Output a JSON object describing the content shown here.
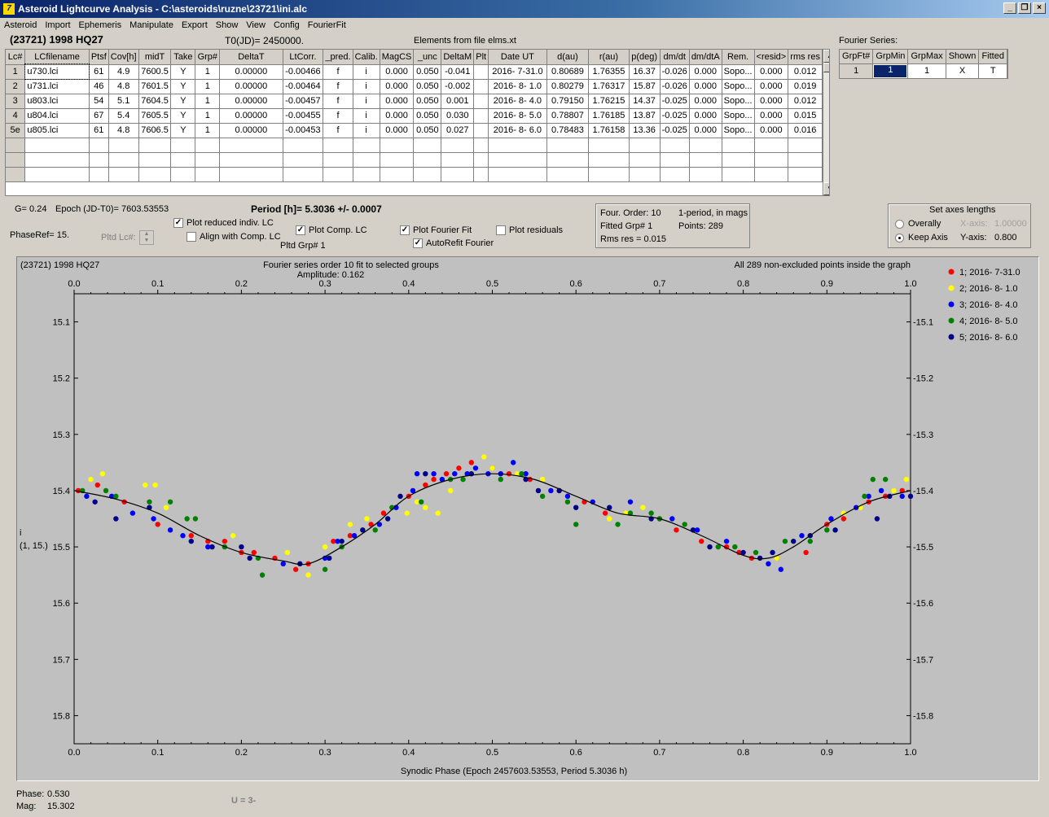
{
  "window": {
    "title": "Asteroid Lightcurve Analysis - C:\\asteroids\\ruzne\\23721\\ini.alc",
    "icon": "app-logo-icon"
  },
  "menu": [
    "Asteroid",
    "Import",
    "Ephemeris",
    "Manipulate",
    "Export",
    "Show",
    "View",
    "Config",
    "FourierFit"
  ],
  "header": {
    "object": "(23721) 1998 HQ27",
    "t0": "T0(JD)= 2450000.",
    "elements": "Elements from file elms.xt",
    "fourier_label": "Fourier Series:"
  },
  "lc_table": {
    "columns": [
      "Lc#",
      "LCfilename",
      "Ptsf",
      "Cov[h]",
      "midT",
      "Take",
      "Grp#",
      "DeltaT",
      "LtCorr.",
      "_pred.",
      "Calib.",
      "MagCS",
      "_unc",
      "DeltaM",
      "Plt",
      "Date UT",
      "d(au)",
      "r(au)",
      "p(deg)",
      "dm/dt",
      "dm/dtA",
      "Rem.",
      "<resid>",
      "rms res"
    ],
    "rows": [
      [
        "1",
        "u730.lci",
        "61",
        "4.9",
        "7600.5",
        "Y",
        "1",
        "0.00000",
        "-0.00466",
        "f",
        "i",
        "0.000",
        "0.050",
        "-0.041",
        "",
        "2016- 7-31.0",
        "0.80689",
        "1.76355",
        "16.37",
        "-0.026",
        "0.000",
        "Sopo...",
        "0.000",
        "0.012"
      ],
      [
        "2",
        "u731.lci",
        "46",
        "4.8",
        "7601.5",
        "Y",
        "1",
        "0.00000",
        "-0.00464",
        "f",
        "i",
        "0.000",
        "0.050",
        "-0.002",
        "",
        "2016- 8- 1.0",
        "0.80279",
        "1.76317",
        "15.87",
        "-0.026",
        "0.000",
        "Sopo...",
        "0.000",
        "0.019"
      ],
      [
        "3",
        "u803.lci",
        "54",
        "5.1",
        "7604.5",
        "Y",
        "1",
        "0.00000",
        "-0.00457",
        "f",
        "i",
        "0.000",
        "0.050",
        "0.001",
        "",
        "2016- 8- 4.0",
        "0.79150",
        "1.76215",
        "14.37",
        "-0.025",
        "0.000",
        "Sopo...",
        "0.000",
        "0.012"
      ],
      [
        "4",
        "u804.lci",
        "67",
        "5.4",
        "7605.5",
        "Y",
        "1",
        "0.00000",
        "-0.00455",
        "f",
        "i",
        "0.000",
        "0.050",
        "0.030",
        "",
        "2016- 8- 5.0",
        "0.78807",
        "1.76185",
        "13.87",
        "-0.025",
        "0.000",
        "Sopo...",
        "0.000",
        "0.015"
      ],
      [
        "5e",
        "u805.lci",
        "61",
        "4.8",
        "7606.5",
        "Y",
        "1",
        "0.00000",
        "-0.00453",
        "f",
        "i",
        "0.000",
        "0.050",
        "0.027",
        "",
        "2016- 8- 6.0",
        "0.78483",
        "1.76158",
        "13.36",
        "-0.025",
        "0.000",
        "Sopo...",
        "0.000",
        "0.016"
      ]
    ]
  },
  "fourier_table": {
    "columns": [
      "GrpFt#",
      "GrpMin",
      "GrpMax",
      "Shown",
      "Fitted"
    ],
    "row": [
      "1",
      "1",
      "1",
      "X",
      "T"
    ]
  },
  "params": {
    "g": "G= 0.24",
    "epoch": "Epoch (JD-T0)= 7603.53553",
    "period": "Period [h]= 5.3036 +/- 0.0007",
    "phaseref": "PhaseRef= 15.",
    "pltd_lc": "Pltd Lc#:",
    "pltd_grp": "Pltd Grp#  1"
  },
  "options": {
    "plot_reduced": {
      "label": "Plot reduced indiv. LC",
      "checked": true
    },
    "align_comp": {
      "label": "Align with Comp. LC",
      "checked": false
    },
    "plot_comp": {
      "label": "Plot Comp. LC",
      "checked": true
    },
    "plot_fourier": {
      "label": "Plot Fourier Fit",
      "checked": true
    },
    "autorefit": {
      "label": "AutoRefit Fourier",
      "checked": true
    },
    "plot_residuals": {
      "label": "Plot residuals",
      "checked": false
    }
  },
  "fit_info": {
    "order": "Four. Order: 10",
    "grp": "Fitted Grp# 1",
    "rms": "Rms res     = 0.015",
    "mode": "1-period, in mags",
    "points": "Points: 289"
  },
  "axes_box": {
    "title": "Set axes lengths",
    "overall": "Overally",
    "keep": "Keep Axis",
    "x_label": "X-axis:",
    "x_value": "1.00000",
    "y_label": "Y-axis:",
    "y_value": "0.800"
  },
  "status": {
    "phase_label": "Phase:",
    "phase_value": "0.530",
    "mag_label": "Mag:",
    "mag_value": "15.302",
    "u": "U = 3-"
  },
  "chart_data": {
    "type": "scatter",
    "title": "(23721) 1998 HQ27",
    "subtitle": "Fourier series order 10 fit to selected groups",
    "amplitude": "Amplitude: 0.162",
    "note": "All 289 non-excluded points inside the graph",
    "xlabel": "Synodic Phase (Epoch 2457603.53553, Period 5.3036 h)",
    "ylabel": "i",
    "ylabel2": "(1, 15.)",
    "xlim": [
      0,
      1
    ],
    "ylim": [
      15.85,
      15.05
    ],
    "xticks": [
      "0.0",
      "0.1",
      "0.2",
      "0.3",
      "0.4",
      "0.5",
      "0.6",
      "0.7",
      "0.8",
      "0.9",
      "1.0"
    ],
    "yticks": [
      "15.1",
      "15.2",
      "15.3",
      "15.4",
      "15.5",
      "15.6",
      "15.7",
      "15.8"
    ],
    "ytick_values": [
      15.1,
      15.2,
      15.3,
      15.4,
      15.5,
      15.6,
      15.7,
      15.8
    ],
    "legend_position": "right",
    "series": [
      {
        "name": "1; 2016- 7-31.0",
        "color": "#ff0000",
        "points": [
          [
            0.005,
            15.4
          ],
          [
            0.028,
            15.39
          ],
          [
            0.06,
            15.42
          ],
          [
            0.1,
            15.46
          ],
          [
            0.14,
            15.48
          ],
          [
            0.16,
            15.49
          ],
          [
            0.18,
            15.49
          ],
          [
            0.2,
            15.51
          ],
          [
            0.215,
            15.51
          ],
          [
            0.24,
            15.52
          ],
          [
            0.265,
            15.54
          ],
          [
            0.28,
            15.53
          ],
          [
            0.31,
            15.49
          ],
          [
            0.33,
            15.48
          ],
          [
            0.355,
            15.46
          ],
          [
            0.37,
            15.44
          ],
          [
            0.4,
            15.41
          ],
          [
            0.42,
            15.39
          ],
          [
            0.43,
            15.38
          ],
          [
            0.445,
            15.37
          ],
          [
            0.46,
            15.36
          ],
          [
            0.475,
            15.35
          ],
          [
            0.5,
            15.36
          ],
          [
            0.52,
            15.37
          ],
          [
            0.545,
            15.38
          ],
          [
            0.58,
            15.4
          ],
          [
            0.61,
            15.42
          ],
          [
            0.635,
            15.44
          ],
          [
            0.7,
            15.45
          ],
          [
            0.72,
            15.47
          ],
          [
            0.75,
            15.49
          ],
          [
            0.78,
            15.5
          ],
          [
            0.795,
            15.51
          ],
          [
            0.81,
            15.52
          ],
          [
            0.84,
            15.52
          ],
          [
            0.875,
            15.51
          ],
          [
            0.9,
            15.46
          ],
          [
            0.92,
            15.45
          ],
          [
            0.95,
            15.42
          ],
          [
            0.97,
            15.41
          ],
          [
            0.99,
            15.4
          ]
        ]
      },
      {
        "name": "2; 2016- 8- 1.0",
        "color": "#ffff00",
        "points": [
          [
            0.02,
            15.38
          ],
          [
            0.034,
            15.37
          ],
          [
            0.085,
            15.39
          ],
          [
            0.097,
            15.39
          ],
          [
            0.11,
            15.43
          ],
          [
            0.19,
            15.48
          ],
          [
            0.255,
            15.51
          ],
          [
            0.28,
            15.55
          ],
          [
            0.3,
            15.5
          ],
          [
            0.33,
            15.46
          ],
          [
            0.35,
            15.45
          ],
          [
            0.398,
            15.44
          ],
          [
            0.41,
            15.42
          ],
          [
            0.42,
            15.43
          ],
          [
            0.435,
            15.44
          ],
          [
            0.45,
            15.4
          ],
          [
            0.49,
            15.34
          ],
          [
            0.5,
            15.36
          ],
          [
            0.53,
            15.37
          ],
          [
            0.56,
            15.38
          ],
          [
            0.62,
            15.42
          ],
          [
            0.64,
            15.45
          ],
          [
            0.66,
            15.44
          ],
          [
            0.68,
            15.43
          ],
          [
            0.84,
            15.52
          ],
          [
            0.86,
            15.49
          ],
          [
            0.92,
            15.44
          ],
          [
            0.94,
            15.43
          ],
          [
            0.98,
            15.4
          ],
          [
            0.995,
            15.38
          ]
        ]
      },
      {
        "name": "3; 2016- 8- 4.0",
        "color": "#0000ff",
        "points": [
          [
            0.015,
            15.41
          ],
          [
            0.045,
            15.41
          ],
          [
            0.07,
            15.44
          ],
          [
            0.095,
            15.45
          ],
          [
            0.115,
            15.47
          ],
          [
            0.13,
            15.48
          ],
          [
            0.16,
            15.5
          ],
          [
            0.25,
            15.53
          ],
          [
            0.3,
            15.52
          ],
          [
            0.315,
            15.49
          ],
          [
            0.335,
            15.48
          ],
          [
            0.365,
            15.46
          ],
          [
            0.385,
            15.43
          ],
          [
            0.405,
            15.4
          ],
          [
            0.41,
            15.37
          ],
          [
            0.43,
            15.37
          ],
          [
            0.44,
            15.38
          ],
          [
            0.455,
            15.37
          ],
          [
            0.47,
            15.37
          ],
          [
            0.48,
            15.36
          ],
          [
            0.495,
            15.37
          ],
          [
            0.51,
            15.37
          ],
          [
            0.525,
            15.35
          ],
          [
            0.54,
            15.37
          ],
          [
            0.57,
            15.4
          ],
          [
            0.59,
            15.41
          ],
          [
            0.62,
            15.42
          ],
          [
            0.665,
            15.42
          ],
          [
            0.715,
            15.45
          ],
          [
            0.745,
            15.47
          ],
          [
            0.78,
            15.49
          ],
          [
            0.83,
            15.53
          ],
          [
            0.845,
            15.54
          ],
          [
            0.87,
            15.48
          ],
          [
            0.905,
            15.45
          ],
          [
            0.935,
            15.43
          ],
          [
            0.95,
            15.41
          ],
          [
            0.965,
            15.4
          ],
          [
            0.99,
            15.41
          ]
        ]
      },
      {
        "name": "4; 2016- 8- 5.0",
        "color": "#008000",
        "points": [
          [
            0.01,
            15.4
          ],
          [
            0.038,
            15.4
          ],
          [
            0.05,
            15.41
          ],
          [
            0.09,
            15.42
          ],
          [
            0.115,
            15.42
          ],
          [
            0.135,
            15.45
          ],
          [
            0.145,
            15.45
          ],
          [
            0.18,
            15.5
          ],
          [
            0.22,
            15.52
          ],
          [
            0.225,
            15.55
          ],
          [
            0.3,
            15.54
          ],
          [
            0.32,
            15.5
          ],
          [
            0.36,
            15.47
          ],
          [
            0.38,
            15.43
          ],
          [
            0.415,
            15.42
          ],
          [
            0.45,
            15.38
          ],
          [
            0.465,
            15.38
          ],
          [
            0.51,
            15.38
          ],
          [
            0.535,
            15.37
          ],
          [
            0.56,
            15.41
          ],
          [
            0.59,
            15.42
          ],
          [
            0.6,
            15.46
          ],
          [
            0.65,
            15.46
          ],
          [
            0.665,
            15.44
          ],
          [
            0.69,
            15.44
          ],
          [
            0.7,
            15.45
          ],
          [
            0.73,
            15.46
          ],
          [
            0.77,
            15.5
          ],
          [
            0.79,
            15.5
          ],
          [
            0.815,
            15.51
          ],
          [
            0.85,
            15.49
          ],
          [
            0.88,
            15.49
          ],
          [
            0.9,
            15.47
          ],
          [
            0.945,
            15.41
          ],
          [
            0.955,
            15.38
          ],
          [
            0.97,
            15.38
          ]
        ]
      },
      {
        "name": "5; 2016- 8- 6.0",
        "color": "#00008b",
        "points": [
          [
            0.025,
            15.42
          ],
          [
            0.05,
            15.45
          ],
          [
            0.09,
            15.43
          ],
          [
            0.14,
            15.49
          ],
          [
            0.165,
            15.5
          ],
          [
            0.2,
            15.5
          ],
          [
            0.21,
            15.52
          ],
          [
            0.27,
            15.53
          ],
          [
            0.305,
            15.52
          ],
          [
            0.32,
            15.49
          ],
          [
            0.345,
            15.47
          ],
          [
            0.375,
            15.45
          ],
          [
            0.39,
            15.41
          ],
          [
            0.42,
            15.37
          ],
          [
            0.475,
            15.37
          ],
          [
            0.54,
            15.38
          ],
          [
            0.555,
            15.4
          ],
          [
            0.58,
            15.4
          ],
          [
            0.6,
            15.43
          ],
          [
            0.64,
            15.43
          ],
          [
            0.69,
            15.45
          ],
          [
            0.74,
            15.47
          ],
          [
            0.76,
            15.5
          ],
          [
            0.8,
            15.51
          ],
          [
            0.82,
            15.52
          ],
          [
            0.835,
            15.51
          ],
          [
            0.86,
            15.49
          ],
          [
            0.88,
            15.48
          ],
          [
            0.91,
            15.47
          ],
          [
            0.96,
            15.45
          ],
          [
            0.975,
            15.41
          ],
          [
            1.0,
            15.41
          ]
        ]
      }
    ],
    "fit": {
      "color": "#000000",
      "points": [
        [
          0,
          15.4
        ],
        [
          0.05,
          15.415
        ],
        [
          0.1,
          15.44
        ],
        [
          0.15,
          15.48
        ],
        [
          0.2,
          15.51
        ],
        [
          0.25,
          15.525
        ],
        [
          0.28,
          15.53
        ],
        [
          0.32,
          15.5
        ],
        [
          0.36,
          15.46
        ],
        [
          0.4,
          15.41
        ],
        [
          0.45,
          15.38
        ],
        [
          0.5,
          15.37
        ],
        [
          0.55,
          15.38
        ],
        [
          0.6,
          15.41
        ],
        [
          0.65,
          15.44
        ],
        [
          0.7,
          15.45
        ],
        [
          0.75,
          15.48
        ],
        [
          0.8,
          15.515
        ],
        [
          0.83,
          15.52
        ],
        [
          0.86,
          15.5
        ],
        [
          0.9,
          15.46
        ],
        [
          0.95,
          15.42
        ],
        [
          1.0,
          15.4
        ]
      ]
    }
  }
}
